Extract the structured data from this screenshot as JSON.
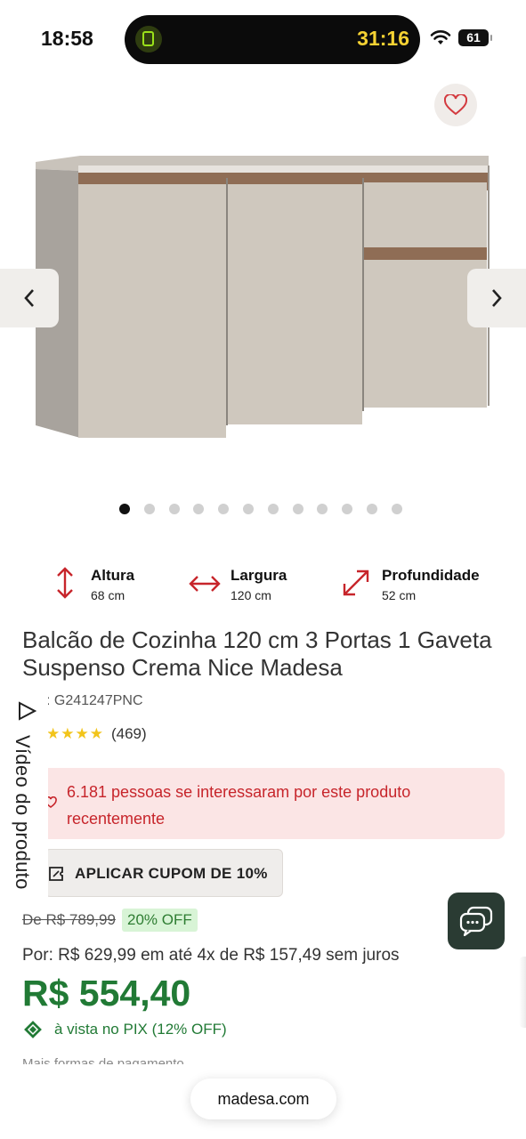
{
  "status_bar": {
    "time": "18:58",
    "timer": "31:16",
    "battery": "61"
  },
  "gallery": {
    "slide_count": 12,
    "active_index": 0
  },
  "dimensions": [
    {
      "label": "Altura",
      "value": "68 cm",
      "icon": "vertical-arrows-icon"
    },
    {
      "label": "Largura",
      "value": "120 cm",
      "icon": "horizontal-arrows-icon"
    },
    {
      "label": "Profundidade",
      "value": "52 cm",
      "icon": "diagonal-arrows-icon"
    }
  ],
  "product": {
    "title": "Balcão de Cozinha 120 cm 3 Portas 1 Gaveta Suspenso Crema Nice Madesa",
    "sku": ": G241247PNC",
    "rating_stars": "★★★★",
    "rating_count": "(469)"
  },
  "interest": {
    "text": "6.181 pessoas se interessaram por este produto recentemente"
  },
  "coupon": {
    "label": "APLICAR CUPOM DE 10%"
  },
  "video_tab": {
    "label": "Vídeo do produto"
  },
  "pricing": {
    "old_price": "De R$ 789,99",
    "discount_badge": "20% OFF",
    "installments": "Por: R$ 629,99 em até 4x de R$ 157,49 sem juros",
    "price": "R$ 554,40",
    "pix_text": "à vista no PIX (12% OFF)",
    "more_payment": "Mais formas de pagamento"
  },
  "browser": {
    "url": "madesa.com"
  },
  "colors": {
    "accent_red": "#c7252b",
    "price_green": "#217a35",
    "chat_bg": "#2a3b33"
  }
}
